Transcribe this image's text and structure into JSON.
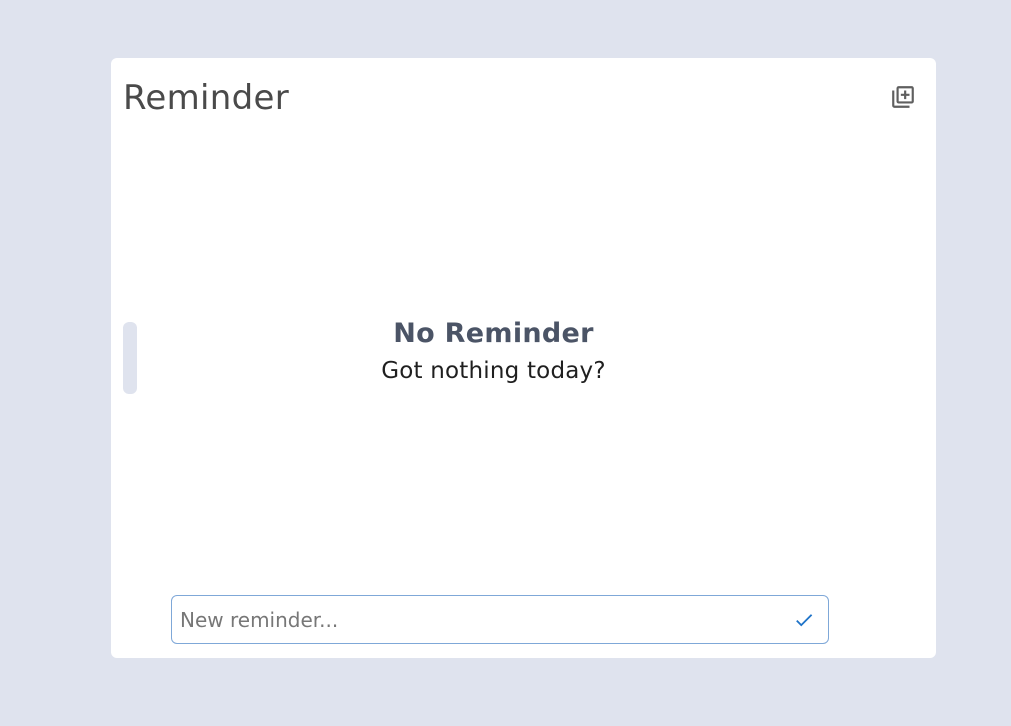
{
  "header": {
    "title": "Reminder",
    "add_icon": "library-add-icon"
  },
  "empty_state": {
    "title": "No Reminder",
    "subtitle": "Got nothing today?"
  },
  "new_reminder": {
    "value": "",
    "placeholder": "New reminder...",
    "submit_icon": "check-icon"
  },
  "colors": {
    "background": "#dfe3ee",
    "card": "#ffffff",
    "accent": "#1e73c8",
    "empty_title": "#4b5466"
  }
}
